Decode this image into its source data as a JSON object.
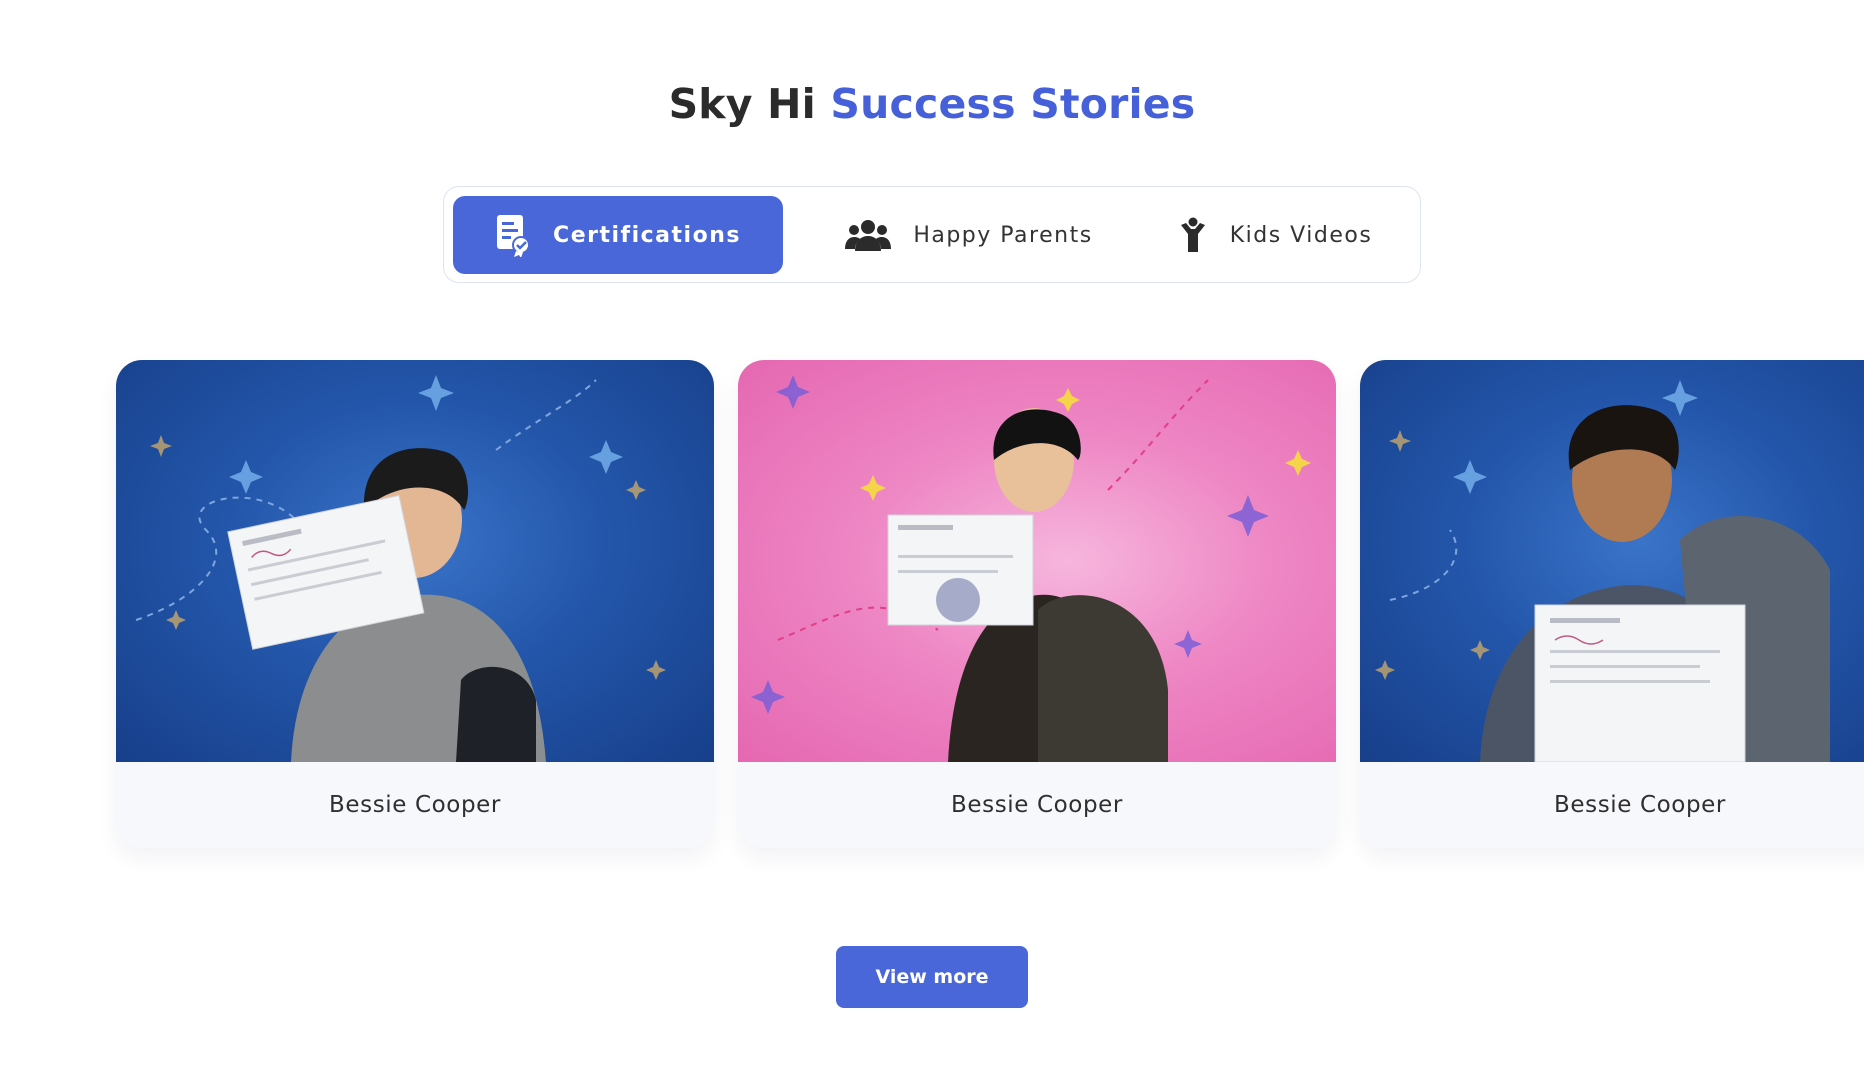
{
  "heading": {
    "part1": "Sky Hi",
    "part2": "Success Stories"
  },
  "tabs": [
    {
      "label": "Certifications",
      "icon": "certificate-icon",
      "active": true
    },
    {
      "label": "Happy Parents",
      "icon": "people-group-icon",
      "active": false
    },
    {
      "label": "Kids Videos",
      "icon": "child-icon",
      "active": false
    }
  ],
  "cards": [
    {
      "name": "Bessie Cooper",
      "background": "blue"
    },
    {
      "name": "Bessie Cooper",
      "background": "pink"
    },
    {
      "name": "Bessie Cooper",
      "background": "blue"
    }
  ],
  "view_more_label": "View more",
  "colors": {
    "accent": "#4560d8",
    "button": "#4a67d9",
    "text": "#2b2b2b"
  }
}
